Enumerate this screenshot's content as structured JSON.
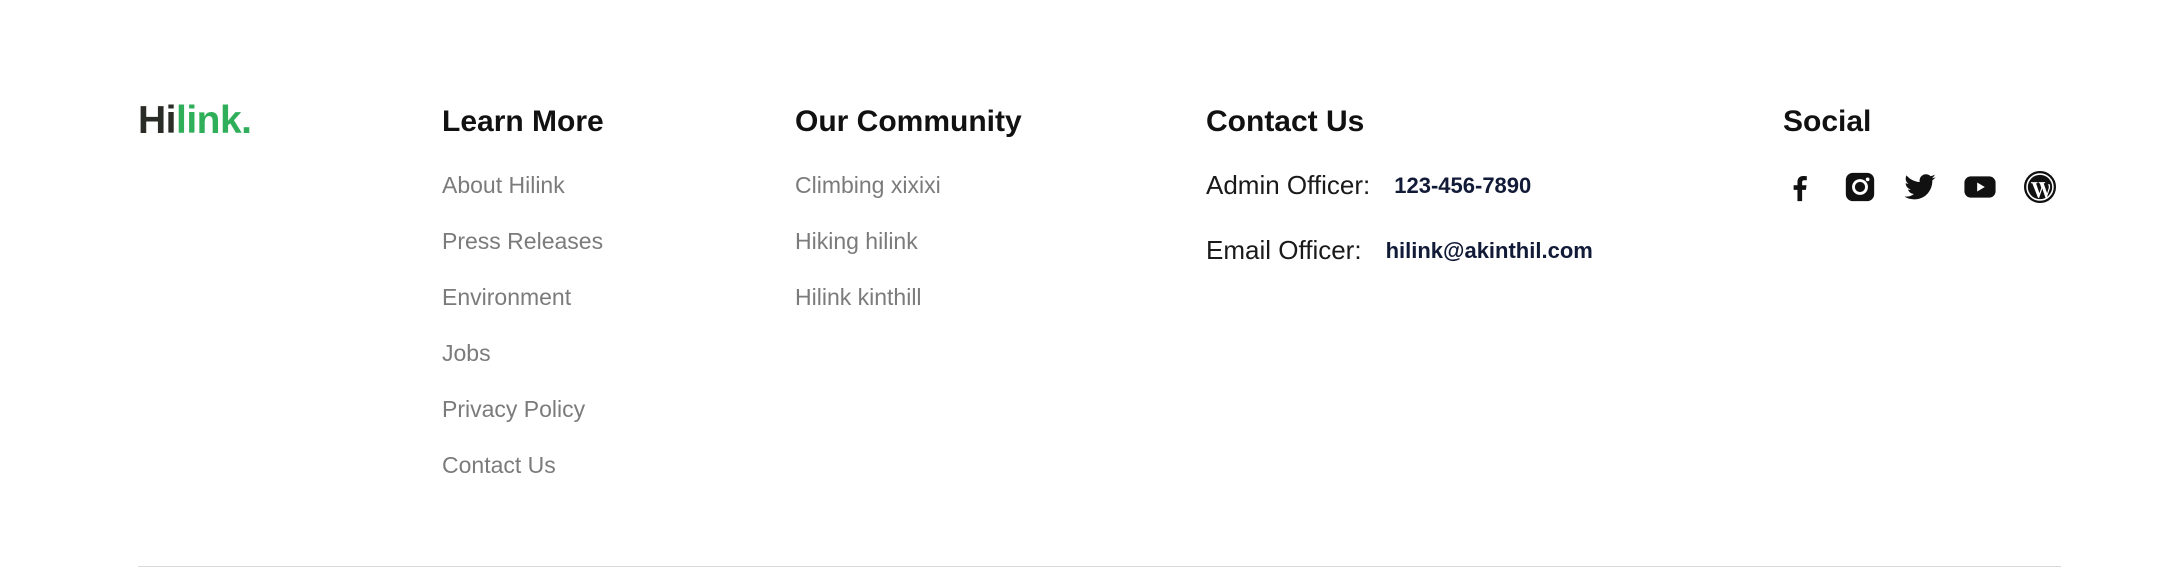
{
  "logo": {
    "part1": "Hi",
    "part2": "link.",
    "color_dark": "#292c27",
    "color_green": "#30af5b"
  },
  "learn_more": {
    "title": "Learn More",
    "links": [
      "About Hilink",
      "Press Releases",
      "Environment",
      "Jobs",
      "Privacy Policy",
      "Contact Us"
    ]
  },
  "community": {
    "title": "Our Community",
    "links": [
      "Climbing xixixi",
      "Hiking hilink",
      "Hilink kinthill"
    ]
  },
  "contact": {
    "title": "Contact Us",
    "rows": [
      {
        "label": "Admin Officer:",
        "value": "123-456-7890"
      },
      {
        "label": "Email Officer:",
        "value": "hilink@akinthil.com"
      }
    ]
  },
  "social": {
    "title": "Social",
    "icons": [
      "facebook-icon",
      "instagram-icon",
      "twitter-icon",
      "youtube-icon",
      "wordpress-icon"
    ]
  }
}
